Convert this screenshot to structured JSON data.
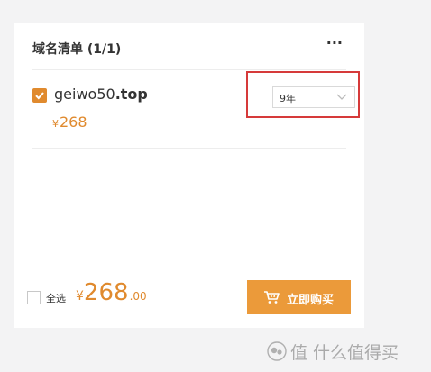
{
  "cart": {
    "title": "域名清单 (1/1)",
    "more": "···"
  },
  "item": {
    "domain_name": "geiwo50",
    "domain_tld": ".top",
    "checked": true,
    "price_symbol": "¥",
    "price": "268",
    "duration": "9年"
  },
  "footer": {
    "select_all": "全选",
    "total_symbol": "¥",
    "total_int": "268",
    "total_dec": ".00",
    "buy_label": "立即购买"
  },
  "watermark": {
    "text": "值 什么值得买"
  },
  "colors": {
    "accent": "#e08a2e",
    "button": "#eb9a3a",
    "highlight": "#d63a3a"
  }
}
